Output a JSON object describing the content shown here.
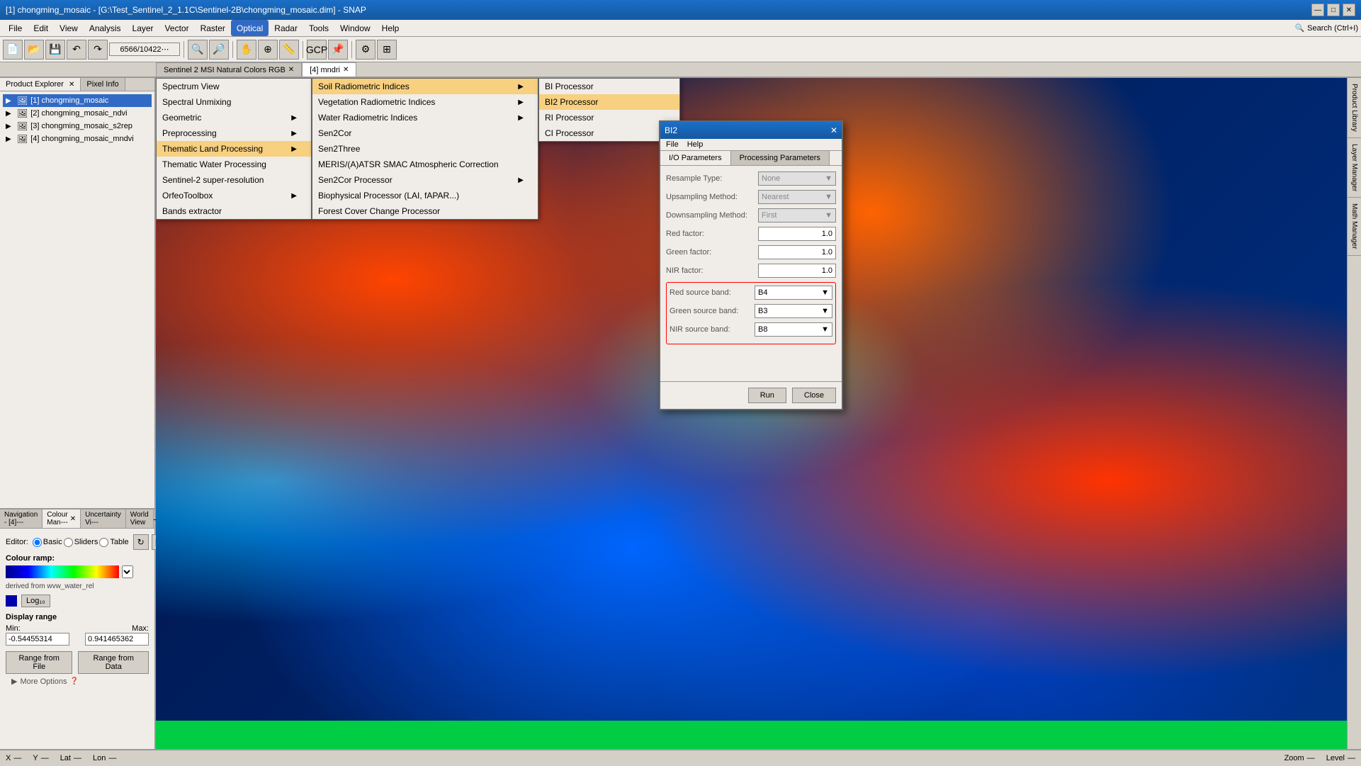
{
  "title_bar": {
    "text": "[1] chongming_mosaic - [G:\\Test_Sentinel_2_1.1C\\Sentinel-2B\\chongming_mosaic.dim] - SNAP",
    "minimize": "—",
    "maximize": "□",
    "close": "✕"
  },
  "menu_bar": {
    "items": [
      "File",
      "Edit",
      "View",
      "Analysis",
      "Layer",
      "Vector",
      "Raster",
      "Optical",
      "Radar",
      "Tools",
      "Window",
      "Help"
    ]
  },
  "product_explorer": {
    "label": "Product Explorer",
    "close": "✕"
  },
  "pixel_info": {
    "label": "Pixel Info"
  },
  "tree_items": [
    {
      "label": "[1] chongming_mosaic",
      "selected": true
    },
    {
      "label": "[2] chongming_mosaic_ndvi",
      "selected": false
    },
    {
      "label": "[3] chongming_mosaic_s2rep",
      "selected": false
    },
    {
      "label": "[4] chongming_mosaic_mndvi",
      "selected": false
    }
  ],
  "image_tabs": [
    {
      "label": "Sentinel 2 MSI Natural Colors RGB",
      "active": false,
      "closable": true
    },
    {
      "label": "[4] mndri",
      "active": true,
      "closable": true
    }
  ],
  "bottom_panel": {
    "tabs": [
      {
        "label": "Navigation - [4]---",
        "active": false
      },
      {
        "label": "Colour Man---",
        "active": true,
        "closable": true
      },
      {
        "label": "Uncertainty Vi---",
        "active": false
      },
      {
        "label": "World View",
        "active": false
      }
    ],
    "editor_label": "Editor:",
    "editor_options": [
      "Basic",
      "Sliders",
      "Table"
    ],
    "colour_ramp_label": "Colour ramp:",
    "colour_ramp_derived": "derived from wvw_water_rel",
    "display_range_label": "Display range",
    "min_label": "Min:",
    "max_label": "Max:",
    "min_value": "-0.54455314",
    "max_value": "0.941465362",
    "range_from_file": "Range from File",
    "range_from_data": "Range from Data",
    "more_options": "More Options"
  },
  "status_bar": {
    "x_label": "X",
    "x_dash": "—",
    "y_label": "Y",
    "y_dash": "—",
    "lat_label": "Lat",
    "lat_dash": "—",
    "lon_label": "Lon",
    "lon_dash": "—",
    "zoom_label": "Zoom",
    "zoom_dash": "—",
    "level_label": "Level",
    "level_dash": "—"
  },
  "land_menu": {
    "title": "Thematic Land Processing",
    "items": [
      {
        "label": "Soil Radiometric Indices",
        "has_submenu": true,
        "highlighted": true
      },
      {
        "label": "Vegetation Radiometric Indices",
        "has_submenu": true
      },
      {
        "label": "Water Radiometric Indices",
        "has_submenu": false
      },
      {
        "label": "Sen2Cor",
        "has_submenu": false
      },
      {
        "label": "Sen2Three",
        "has_submenu": false
      },
      {
        "label": "MERIS/(A)ATSR SMAC Atmospheric Correction",
        "has_submenu": false
      },
      {
        "label": "Sen2Cor Processor",
        "has_submenu": true
      },
      {
        "label": "Biophysical Processor (LAI, fAPAR...)",
        "has_submenu": false
      },
      {
        "label": "Forest Cover Change Processor",
        "has_submenu": false
      }
    ]
  },
  "optical_menu": {
    "items": [
      {
        "label": "Spectrum View"
      },
      {
        "label": "Spectral Unmixing"
      },
      {
        "label": "Geometric",
        "has_submenu": true
      },
      {
        "label": "Preprocessing",
        "has_submenu": true
      },
      {
        "label": "Thematic Land Processing",
        "has_submenu": true,
        "active": true
      },
      {
        "label": "Thematic Water Processing"
      },
      {
        "label": "Sentinel-2 super-resolution"
      },
      {
        "label": "OrfeoToolbox",
        "has_submenu": true
      },
      {
        "label": "Bands extractor"
      }
    ]
  },
  "soil_submenu": {
    "items": [
      {
        "label": "BI Processor"
      },
      {
        "label": "BI2 Processor",
        "highlighted": true
      },
      {
        "label": "RI Processor"
      },
      {
        "label": "CI Processor"
      }
    ]
  },
  "dialog": {
    "title": "BI2",
    "menu": [
      "File",
      "Help"
    ],
    "tabs": [
      "I/O Parameters",
      "Processing Parameters"
    ],
    "active_tab": "I/O Parameters",
    "fields": [
      {
        "label": "Resample Type:",
        "value": "None",
        "type": "select",
        "disabled": true
      },
      {
        "label": "Upsampling Method:",
        "value": "Nearest",
        "type": "select",
        "disabled": true
      },
      {
        "label": "Downsampling Method:",
        "value": "First",
        "type": "select",
        "disabled": true
      },
      {
        "label": "Red factor:",
        "value": "1.0",
        "type": "input"
      },
      {
        "label": "Green factor:",
        "value": "1.0",
        "type": "input"
      },
      {
        "label": "NIR factor:",
        "value": "1.0",
        "type": "input"
      }
    ],
    "source_bands": [
      {
        "label": "Red source band:",
        "value": "B4",
        "type": "select"
      },
      {
        "label": "Green source band:",
        "value": "B3",
        "type": "select"
      },
      {
        "label": "NIR source band:",
        "value": "B8",
        "type": "select"
      }
    ],
    "buttons": [
      "Run",
      "Close"
    ]
  }
}
